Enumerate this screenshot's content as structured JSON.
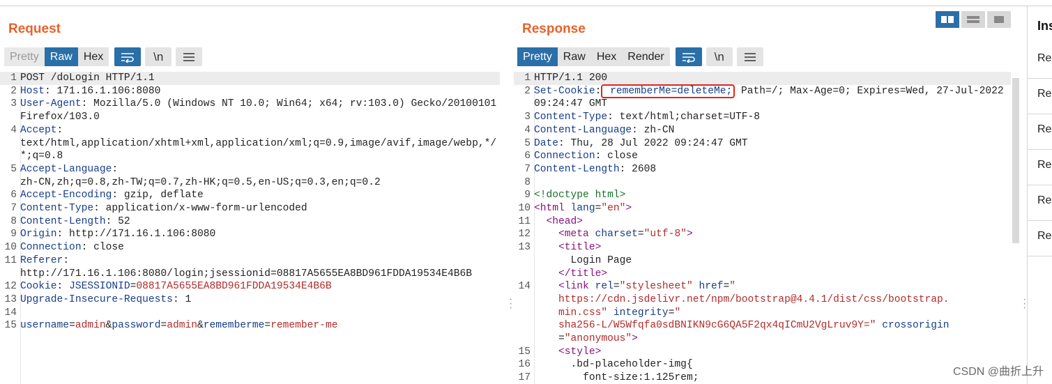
{
  "request": {
    "title": "Request",
    "tabs": [
      "Pretty",
      "Raw",
      "Hex"
    ],
    "active_tab": "Raw",
    "wrap_label": "\\n",
    "lines": [
      {
        "n": "1",
        "hl": true,
        "parts": [
          {
            "c": "v",
            "t": "POST /doLogin HTTP/1.1"
          }
        ]
      },
      {
        "n": "2",
        "parts": [
          {
            "c": "k",
            "t": "Host"
          },
          {
            "c": "v",
            "t": ": 171.16.1.106:8080"
          }
        ]
      },
      {
        "n": "3",
        "parts": [
          {
            "c": "k",
            "t": "User-Agent"
          },
          {
            "c": "v",
            "t": ": Mozilla/5.0 (Windows NT 10.0; Win64; x64; rv:103.0) Gecko/20100101 Firefox/103.0"
          }
        ]
      },
      {
        "n": "4",
        "parts": [
          {
            "c": "k",
            "t": "Accept"
          },
          {
            "c": "v",
            "t": ":\ntext/html,application/xhtml+xml,application/xml;q=0.9,image/avif,image/webp,*/*;q=0.8"
          }
        ]
      },
      {
        "n": "5",
        "parts": [
          {
            "c": "k",
            "t": "Accept-Language"
          },
          {
            "c": "v",
            "t": ":\nzh-CN,zh;q=0.8,zh-TW;q=0.7,zh-HK;q=0.5,en-US;q=0.3,en;q=0.2"
          }
        ]
      },
      {
        "n": "6",
        "parts": [
          {
            "c": "k",
            "t": "Accept-Encoding"
          },
          {
            "c": "v",
            "t": ": gzip, deflate"
          }
        ]
      },
      {
        "n": "7",
        "parts": [
          {
            "c": "k",
            "t": "Content-Type"
          },
          {
            "c": "v",
            "t": ": application/x-www-form-urlencoded"
          }
        ]
      },
      {
        "n": "8",
        "parts": [
          {
            "c": "k",
            "t": "Content-Length"
          },
          {
            "c": "v",
            "t": ": 52"
          }
        ]
      },
      {
        "n": "9",
        "parts": [
          {
            "c": "k",
            "t": "Origin"
          },
          {
            "c": "v",
            "t": ": http://171.16.1.106:8080"
          }
        ]
      },
      {
        "n": "10",
        "parts": [
          {
            "c": "k",
            "t": "Connection"
          },
          {
            "c": "v",
            "t": ": close"
          }
        ]
      },
      {
        "n": "11",
        "parts": [
          {
            "c": "k",
            "t": "Referer"
          },
          {
            "c": "v",
            "t": ":\nhttp://171.16.1.106:8080/login;jsessionid=08817A5655EA8BD961FDDA19534E4B6B"
          }
        ]
      },
      {
        "n": "12",
        "parts": [
          {
            "c": "k",
            "t": "Cookie"
          },
          {
            "c": "v",
            "t": ": "
          },
          {
            "c": "pn",
            "t": "JSESSIONID"
          },
          {
            "c": "v",
            "t": "="
          },
          {
            "c": "pv",
            "t": "08817A5655EA8BD961FDDA19534E4B6B"
          }
        ]
      },
      {
        "n": "13",
        "parts": [
          {
            "c": "k",
            "t": "Upgrade-Insecure-Requests"
          },
          {
            "c": "v",
            "t": ": 1"
          }
        ]
      },
      {
        "n": "14",
        "parts": [
          {
            "c": "v",
            "t": ""
          }
        ]
      },
      {
        "n": "15",
        "parts": [
          {
            "c": "pn",
            "t": "username"
          },
          {
            "c": "v",
            "t": "="
          },
          {
            "c": "pv",
            "t": "admin"
          },
          {
            "c": "v",
            "t": "&"
          },
          {
            "c": "pn",
            "t": "password"
          },
          {
            "c": "v",
            "t": "="
          },
          {
            "c": "pv",
            "t": "admin"
          },
          {
            "c": "v",
            "t": "&"
          },
          {
            "c": "pn",
            "t": "rememberme"
          },
          {
            "c": "v",
            "t": "="
          },
          {
            "c": "pv",
            "t": "remember-me"
          }
        ]
      }
    ]
  },
  "response": {
    "title": "Response",
    "tabs": [
      "Pretty",
      "Raw",
      "Hex",
      "Render"
    ],
    "active_tab": "Pretty",
    "wrap_label": "\\n",
    "lines": [
      {
        "n": "1",
        "hl": true,
        "parts": [
          {
            "c": "v",
            "t": "HTTP/1.1 200"
          }
        ]
      },
      {
        "n": "2",
        "parts": [
          {
            "c": "k",
            "t": "Set-Cookie"
          },
          {
            "c": "v",
            "t": ":"
          },
          {
            "c": "box",
            "t": " rememberMe=deleteMe;"
          },
          {
            "c": "v",
            "t": " Path=/; Max-Age=0; Expires=Wed, 27-Jul-2022 09:24:47 GMT"
          }
        ]
      },
      {
        "n": "3",
        "parts": [
          {
            "c": "k",
            "t": "Content-Type"
          },
          {
            "c": "v",
            "t": ": text/html;charset=UTF-8"
          }
        ]
      },
      {
        "n": "4",
        "parts": [
          {
            "c": "k",
            "t": "Content-Language"
          },
          {
            "c": "v",
            "t": ": zh-CN"
          }
        ]
      },
      {
        "n": "5",
        "parts": [
          {
            "c": "k",
            "t": "Date"
          },
          {
            "c": "v",
            "t": ": Thu, 28 Jul 2022 09:24:47 GMT"
          }
        ]
      },
      {
        "n": "6",
        "parts": [
          {
            "c": "k",
            "t": "Connection"
          },
          {
            "c": "v",
            "t": ": close"
          }
        ]
      },
      {
        "n": "7",
        "parts": [
          {
            "c": "k",
            "t": "Content-Length"
          },
          {
            "c": "v",
            "t": ": 2608"
          }
        ]
      },
      {
        "n": "8",
        "parts": [
          {
            "c": "v",
            "t": ""
          }
        ]
      },
      {
        "n": "9",
        "parts": [
          {
            "c": "tagc",
            "t": "<!doctype html>"
          }
        ]
      },
      {
        "n": "10",
        "parts": [
          {
            "c": "tag",
            "t": "<html "
          },
          {
            "c": "atn",
            "t": "lang"
          },
          {
            "c": "v",
            "t": "="
          },
          {
            "c": "atv",
            "t": "\"en\""
          },
          {
            "c": "tag",
            "t": ">"
          }
        ]
      },
      {
        "n": "11",
        "parts": [
          {
            "c": "tag",
            "t": "  <head>"
          }
        ]
      },
      {
        "n": "12",
        "parts": [
          {
            "c": "tag",
            "t": "    <meta "
          },
          {
            "c": "atn",
            "t": "charset"
          },
          {
            "c": "v",
            "t": "="
          },
          {
            "c": "atv",
            "t": "\"utf-8\""
          },
          {
            "c": "tag",
            "t": ">"
          }
        ]
      },
      {
        "n": "13",
        "parts": [
          {
            "c": "tag",
            "t": "    <title>"
          },
          {
            "c": "v",
            "t": "\n      Login Page\n"
          },
          {
            "c": "tag",
            "t": "    </title>"
          }
        ]
      },
      {
        "n": "14",
        "parts": [
          {
            "c": "tag",
            "t": "    <link "
          },
          {
            "c": "atn",
            "t": "rel"
          },
          {
            "c": "v",
            "t": "="
          },
          {
            "c": "atv",
            "t": "\"stylesheet\""
          },
          {
            "c": "v",
            "t": " "
          },
          {
            "c": "atn",
            "t": "href"
          },
          {
            "c": "v",
            "t": "="
          },
          {
            "c": "atv",
            "t": "\"\n    https://cdn.jsdelivr.net/npm/bootstrap@4.4.1/dist/css/bootstrap.\n    min.css\""
          },
          {
            "c": "v",
            "t": " "
          },
          {
            "c": "atn",
            "t": "integrity"
          },
          {
            "c": "v",
            "t": "="
          },
          {
            "c": "atv",
            "t": "\"\n    sha256-L/W5Wfqfa0sdBNIKN9cG6QA5F2qx4qICmU2VgLruv9Y=\""
          },
          {
            "c": "v",
            "t": " "
          },
          {
            "c": "atn",
            "t": "crossorigin"
          },
          {
            "c": "v",
            "t": "\n    ="
          },
          {
            "c": "atv",
            "t": "\"anonymous\""
          },
          {
            "c": "tag",
            "t": ">"
          }
        ]
      },
      {
        "n": "15",
        "parts": [
          {
            "c": "tag",
            "t": "    <style>"
          }
        ]
      },
      {
        "n": "16",
        "parts": [
          {
            "c": "v",
            "t": "      .bd-placeholder-img{"
          }
        ]
      },
      {
        "n": "17",
        "parts": [
          {
            "c": "v",
            "t": "        font-size:1.125rem;"
          }
        ]
      }
    ]
  },
  "inspector": {
    "title": "Ins",
    "rows": [
      "Req",
      "Req",
      "Req",
      "Req",
      "Req",
      "Res"
    ]
  },
  "watermark": "CSDN @曲折上升"
}
